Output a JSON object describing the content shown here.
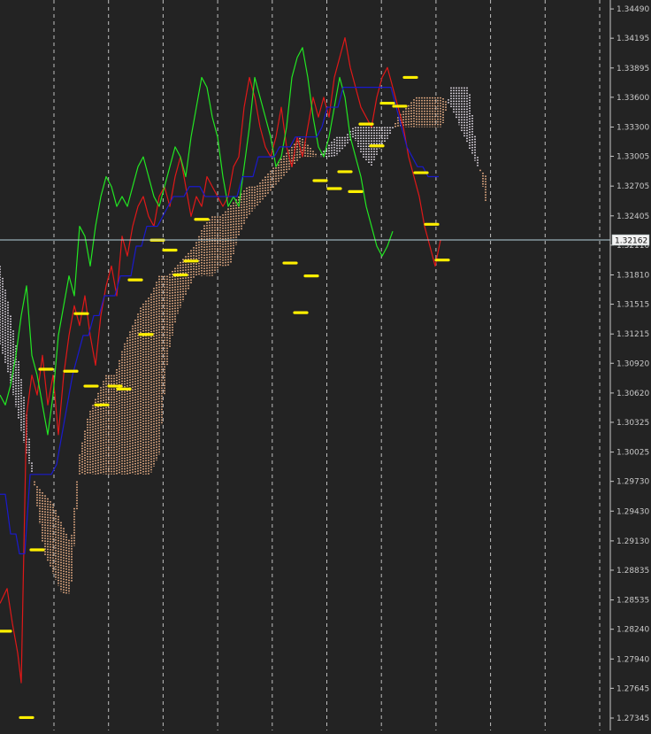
{
  "chart_data": {
    "type": "line",
    "title": "",
    "xlabel": "",
    "ylabel": "",
    "ylim": [
      1.2722,
      1.3458
    ],
    "grid": "vertical-dashed",
    "y_ticks": [
      1.3449,
      1.34195,
      1.33895,
      1.336,
      1.333,
      1.33005,
      1.32705,
      1.32405,
      1.3211,
      1.3181,
      1.31515,
      1.31215,
      1.3092,
      1.3062,
      1.30325,
      1.30025,
      1.2973,
      1.2943,
      1.2913,
      1.28835,
      1.28535,
      1.2824,
      1.2794,
      1.27645,
      1.27345
    ],
    "y_tick_labels": [
      "1.34490",
      "1.34195",
      "1.33895",
      "1.33600",
      "1.33300",
      "1.33005",
      "1.32705",
      "1.32405",
      "1.32110",
      "1.31810",
      "1.31515",
      "1.31215",
      "1.30920",
      "1.30620",
      "1.30325",
      "1.30025",
      "1.29730",
      "1.29430",
      "1.29130",
      "1.28835",
      "1.28535",
      "1.28240",
      "1.27940",
      "1.27645",
      "1.27345"
    ],
    "current_price": 1.32162,
    "current_price_label": "1.32162",
    "colors": {
      "background": "#232323",
      "grid": "#e6e6e6",
      "axis": "#c8c8c8",
      "price_line": "#b4d2dc",
      "close_line": "#e01818",
      "chikou": "#22e622",
      "kijun": "#1a1acd",
      "cloud_bull": "#f4b68a",
      "cloud_bear": "#ece4f0",
      "markers": "#ffef00",
      "label_box": "#f2f2f2",
      "label_text": "#111111"
    },
    "series": [
      {
        "key": "close",
        "x": [
          0,
          8,
          14,
          20,
          24,
          30,
          36,
          42,
          48,
          54,
          60,
          66,
          72,
          78,
          84,
          90,
          96,
          102,
          108,
          114,
          120,
          126,
          132,
          138,
          144,
          150,
          156,
          162,
          168,
          174,
          180,
          186,
          192,
          198,
          204,
          210,
          216,
          222,
          228,
          234,
          240,
          246,
          252,
          258,
          264,
          270,
          276,
          282,
          288,
          294,
          300,
          306,
          312,
          318,
          324,
          330,
          336,
          342,
          348,
          354,
          360,
          366,
          372,
          378,
          384,
          390,
          396,
          402,
          408,
          414,
          420,
          426,
          432,
          438,
          444,
          450,
          456,
          462,
          468,
          474,
          480,
          486,
          492,
          498
        ],
        "values": [
          1.285,
          1.2865,
          1.283,
          1.28,
          1.277,
          1.304,
          1.308,
          1.306,
          1.31,
          1.305,
          1.308,
          1.302,
          1.308,
          1.312,
          1.315,
          1.313,
          1.316,
          1.312,
          1.309,
          1.314,
          1.317,
          1.319,
          1.316,
          1.322,
          1.32,
          1.323,
          1.325,
          1.326,
          1.324,
          1.323,
          1.326,
          1.327,
          1.325,
          1.328,
          1.33,
          1.327,
          1.324,
          1.326,
          1.325,
          1.328,
          1.327,
          1.326,
          1.325,
          1.326,
          1.329,
          1.33,
          1.335,
          1.338,
          1.336,
          1.333,
          1.331,
          1.33,
          1.332,
          1.335,
          1.331,
          1.329,
          1.332,
          1.33,
          1.333,
          1.336,
          1.334,
          1.336,
          1.334,
          1.338,
          1.34,
          1.342,
          1.339,
          1.337,
          1.335,
          1.334,
          1.333,
          1.336,
          1.338,
          1.339,
          1.337,
          1.335,
          1.333,
          1.33,
          1.328,
          1.326,
          1.323,
          1.321,
          1.319,
          1.3216
        ]
      },
      {
        "key": "chikou",
        "x": [
          0,
          6,
          12,
          18,
          24,
          30,
          36,
          42,
          48,
          54,
          60,
          66,
          72,
          78,
          84,
          90,
          96,
          102,
          108,
          114,
          120,
          126,
          132,
          138,
          144,
          150,
          156,
          162,
          168,
          174,
          180,
          186,
          192,
          198,
          204,
          210,
          216,
          222,
          228,
          234,
          240,
          246,
          252,
          258,
          264,
          270,
          276,
          282,
          288,
          294,
          300,
          306,
          312,
          318,
          324,
          330,
          336,
          342,
          348,
          354,
          360,
          366,
          372,
          378,
          384,
          390,
          396,
          402,
          408,
          414,
          420,
          426,
          432,
          438,
          444
        ],
        "values": [
          1.306,
          1.305,
          1.307,
          1.31,
          1.314,
          1.317,
          1.31,
          1.308,
          1.305,
          1.302,
          1.306,
          1.312,
          1.315,
          1.318,
          1.316,
          1.323,
          1.322,
          1.319,
          1.323,
          1.326,
          1.328,
          1.327,
          1.325,
          1.326,
          1.325,
          1.327,
          1.329,
          1.33,
          1.328,
          1.326,
          1.325,
          1.327,
          1.329,
          1.331,
          1.33,
          1.328,
          1.332,
          1.335,
          1.338,
          1.337,
          1.334,
          1.332,
          1.328,
          1.325,
          1.326,
          1.325,
          1.329,
          1.333,
          1.338,
          1.336,
          1.334,
          1.332,
          1.329,
          1.33,
          1.333,
          1.338,
          1.34,
          1.341,
          1.338,
          1.334,
          1.331,
          1.33,
          1.332,
          1.335,
          1.338,
          1.336,
          1.332,
          1.33,
          1.328,
          1.325,
          1.323,
          1.321,
          1.32,
          1.321,
          1.3225
        ]
      },
      {
        "key": "kijun",
        "x": [
          0,
          6,
          12,
          18,
          22,
          28,
          34,
          40,
          46,
          52,
          58,
          64,
          70,
          76,
          82,
          88,
          94,
          100,
          106,
          112,
          118,
          124,
          130,
          136,
          142,
          148,
          154,
          160,
          166,
          172,
          178,
          184,
          190,
          196,
          202,
          208,
          214,
          220,
          226,
          232,
          238,
          244,
          250,
          256,
          262,
          268,
          274,
          280,
          286,
          292,
          298,
          304,
          310,
          316,
          322,
          328,
          334,
          340,
          346,
          352,
          358,
          364,
          370,
          376,
          382,
          388,
          394,
          400,
          406,
          412,
          418,
          424,
          430,
          436,
          442,
          448,
          454,
          460,
          466,
          472,
          478,
          484,
          490,
          496
        ],
        "values": [
          1.296,
          1.296,
          1.292,
          1.292,
          1.29,
          1.29,
          1.298,
          1.298,
          1.298,
          1.298,
          1.298,
          1.299,
          1.302,
          1.305,
          1.308,
          1.31,
          1.312,
          1.312,
          1.314,
          1.314,
          1.316,
          1.316,
          1.316,
          1.318,
          1.318,
          1.318,
          1.321,
          1.321,
          1.323,
          1.323,
          1.323,
          1.324,
          1.325,
          1.326,
          1.326,
          1.326,
          1.327,
          1.327,
          1.327,
          1.326,
          1.326,
          1.326,
          1.326,
          1.326,
          1.326,
          1.326,
          1.328,
          1.328,
          1.328,
          1.33,
          1.33,
          1.33,
          1.33,
          1.331,
          1.331,
          1.331,
          1.332,
          1.332,
          1.332,
          1.332,
          1.332,
          1.333,
          1.335,
          1.335,
          1.335,
          1.337,
          1.337,
          1.337,
          1.337,
          1.337,
          1.337,
          1.337,
          1.337,
          1.337,
          1.337,
          1.335,
          1.333,
          1.331,
          1.33,
          1.329,
          1.329,
          1.328,
          1.328,
          1.328
        ]
      }
    ],
    "cloud": {
      "x": [
        0,
        10,
        20,
        30,
        40,
        50,
        60,
        70,
        80,
        90,
        100,
        110,
        120,
        130,
        140,
        150,
        160,
        170,
        180,
        190,
        200,
        210,
        220,
        230,
        240,
        250,
        260,
        270,
        280,
        290,
        300,
        310,
        320,
        330,
        340,
        350,
        360,
        370,
        380,
        390,
        400,
        410,
        420,
        430,
        440,
        450,
        460,
        470,
        480,
        490,
        500,
        510,
        520,
        530,
        540,
        550
      ],
      "span_a": [
        1.311,
        1.308,
        1.304,
        1.3,
        1.297,
        1.296,
        1.295,
        1.293,
        1.291,
        1.3,
        1.304,
        1.306,
        1.308,
        1.308,
        1.311,
        1.313,
        1.315,
        1.316,
        1.318,
        1.318,
        1.319,
        1.32,
        1.321,
        1.323,
        1.324,
        1.324,
        1.325,
        1.326,
        1.327,
        1.327,
        1.328,
        1.329,
        1.33,
        1.331,
        1.332,
        1.331,
        1.33,
        1.33,
        1.33,
        1.331,
        1.332,
        1.33,
        1.329,
        1.331,
        1.332,
        1.334,
        1.335,
        1.336,
        1.336,
        1.336,
        1.336,
        1.335,
        1.333,
        1.331,
        1.329,
        1.328
      ],
      "span_b": [
        1.319,
        1.315,
        1.31,
        1.304,
        1.296,
        1.29,
        1.288,
        1.286,
        1.286,
        1.298,
        1.298,
        1.298,
        1.298,
        1.298,
        1.298,
        1.298,
        1.298,
        1.298,
        1.3,
        1.31,
        1.314,
        1.316,
        1.318,
        1.318,
        1.318,
        1.319,
        1.319,
        1.322,
        1.324,
        1.325,
        1.326,
        1.327,
        1.328,
        1.329,
        1.33,
        1.33,
        1.33,
        1.331,
        1.332,
        1.332,
        1.333,
        1.333,
        1.333,
        1.333,
        1.333,
        1.333,
        1.333,
        1.333,
        1.333,
        1.333,
        1.333,
        1.337,
        1.337,
        1.337,
        1.33,
        1.325
      ]
    },
    "markers": {
      "x": [
        5,
        30,
        42,
        52,
        80,
        92,
        103,
        115,
        130,
        140,
        153,
        165,
        178,
        192,
        204,
        216,
        228,
        328,
        340,
        352,
        362,
        378,
        390,
        402,
        414,
        426,
        438,
        452,
        464,
        476,
        488,
        500
      ],
      "values": [
        1.2822,
        1.2735,
        1.2904,
        1.3086,
        1.3084,
        1.3142,
        1.3069,
        1.305,
        1.3069,
        1.3066,
        1.3176,
        1.3121,
        1.3216,
        1.3206,
        1.3181,
        1.3195,
        1.3237,
        1.3193,
        1.3143,
        1.318,
        1.3276,
        1.3268,
        1.3285,
        1.3265,
        1.3333,
        1.3311,
        1.3354,
        1.3351,
        1.338,
        1.3284,
        1.3232,
        1.3196
      ]
    }
  }
}
